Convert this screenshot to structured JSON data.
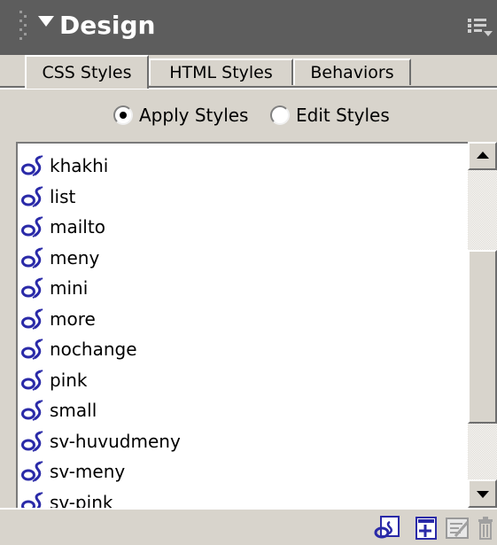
{
  "panel": {
    "title": "Design"
  },
  "tabs": [
    {
      "label": "CSS Styles",
      "active": true
    },
    {
      "label": "HTML Styles",
      "active": false
    },
    {
      "label": "Behaviors",
      "active": false
    }
  ],
  "mode": {
    "apply_label": "Apply Styles",
    "edit_label": "Edit Styles",
    "selected": "apply"
  },
  "styles": [
    {
      "name": "khakhi"
    },
    {
      "name": "list"
    },
    {
      "name": "mailto"
    },
    {
      "name": "meny"
    },
    {
      "name": "mini"
    },
    {
      "name": "more"
    },
    {
      "name": "nochange"
    },
    {
      "name": "pink"
    },
    {
      "name": "small"
    },
    {
      "name": "sv-huvudmeny"
    },
    {
      "name": "sv-meny"
    },
    {
      "name": "sv-pink"
    }
  ],
  "toolbar": {
    "buttons": [
      {
        "icon": "attach-style-sheet-icon"
      },
      {
        "icon": "new-style-icon"
      },
      {
        "icon": "edit-style-sheet-icon"
      },
      {
        "icon": "delete-style-icon"
      }
    ]
  },
  "colors": {
    "header_bg": "#5d5d5d",
    "panel_bg": "#d8d4cc",
    "icon_blue": "#2a2aa8"
  }
}
